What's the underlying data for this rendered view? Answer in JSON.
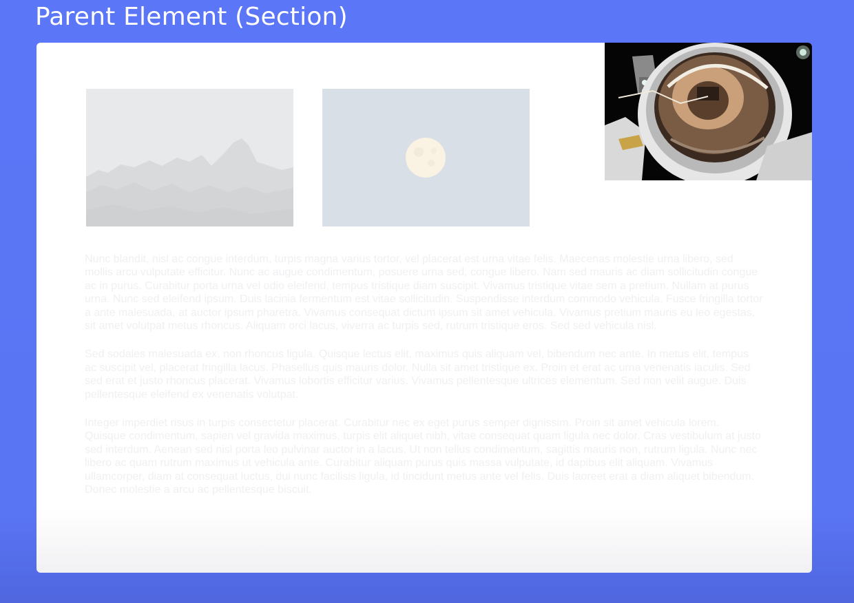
{
  "header": {
    "title": "Parent Element (Section)"
  },
  "images": [
    {
      "name": "mountains",
      "description": "faded-landscape"
    },
    {
      "name": "moon",
      "description": "faded-moon"
    },
    {
      "name": "astronaut",
      "description": "astronaut-selfie"
    }
  ],
  "content": {
    "paragraphs": [
      "Nunc blandit, nisl ac congue interdum, turpis magna varius tortor, vel placerat est urna vitae felis. Maecenas molestie urna libero, sed mollis arcu vulputate efficitur. Nunc ac augue condimentum, posuere urna sed, congue libero. Nam sed mauris ac diam sollicitudin congue ac in purus. Curabitur porta urna vel odio eleifend, tempus tristique diam suscipit. Vivamus tristique vitae sem a pretium. Nullam at purus urna. Nunc sed eleifend ipsum. Duis lacinia fermentum est vitae sollicitudin. Suspendisse interdum commodo vehicula. Fusce fringilla tortor a ante malesuada, at auctor ipsum pharetra. Vivamus consequat dictum ipsum sit amet vehicula. Vivamus pretium mauris eu leo egestas, sit amet volutpat metus rhoncus. Aliquam orci lacus, viverra ac turpis sed, rutrum tristique eros. Sed sed vehicula nisl.",
      "Sed sodales malesuada ex, non rhoncus ligula. Quisque lectus elit, maximus quis aliquam vel, bibendum nec ante. In metus elit, tempus ac suscipit vel, placerat fringilla lacus. Phasellus quis mauris dolor. Nulla sit amet tristique ex. Proin et erat ac urna venenatis iaculis. Sed sed erat et justo rhoncus placerat. Vivamus lobortis efficitur varius. Vivamus pellentesque ultrices elementum. Sed non velit augue. Duis pellentesque eleifend ex venenatis volutpat.",
      "Integer imperdiet risus in turpis consectetur placerat. Curabitur nec ex eget purus semper dignissim. Proin sit amet vehicula lorem. Quisque condimentum, sapien vel gravida maximus, turpis elit aliquet nibh, vitae consequat quam ligula nec dolor. Cras vestibulum at justo sed interdum. Aenean sed nisl porta leo pulvinar auctor in a lacus. Ut non tellus condimentum, sagittis mauris non, rutrum ligula. Nunc nec libero ac quam rutrum maximus ut vehicula ante. Curabitur aliquam purus quis massa vulputate, id dapibus elit aliquam. Vivamus ullamcorper, diam at consequat luctus, dui nunc facilisis ligula, id tincidunt metus ante vel felis. Duis laoreet erat a diam aliquet bibendum. Donec molestie a arcu ac pellentesque biscuit."
    ]
  },
  "colors": {
    "background": "#5b76f6",
    "card": "#ffffff",
    "faded_text": "#f0f0f2"
  }
}
